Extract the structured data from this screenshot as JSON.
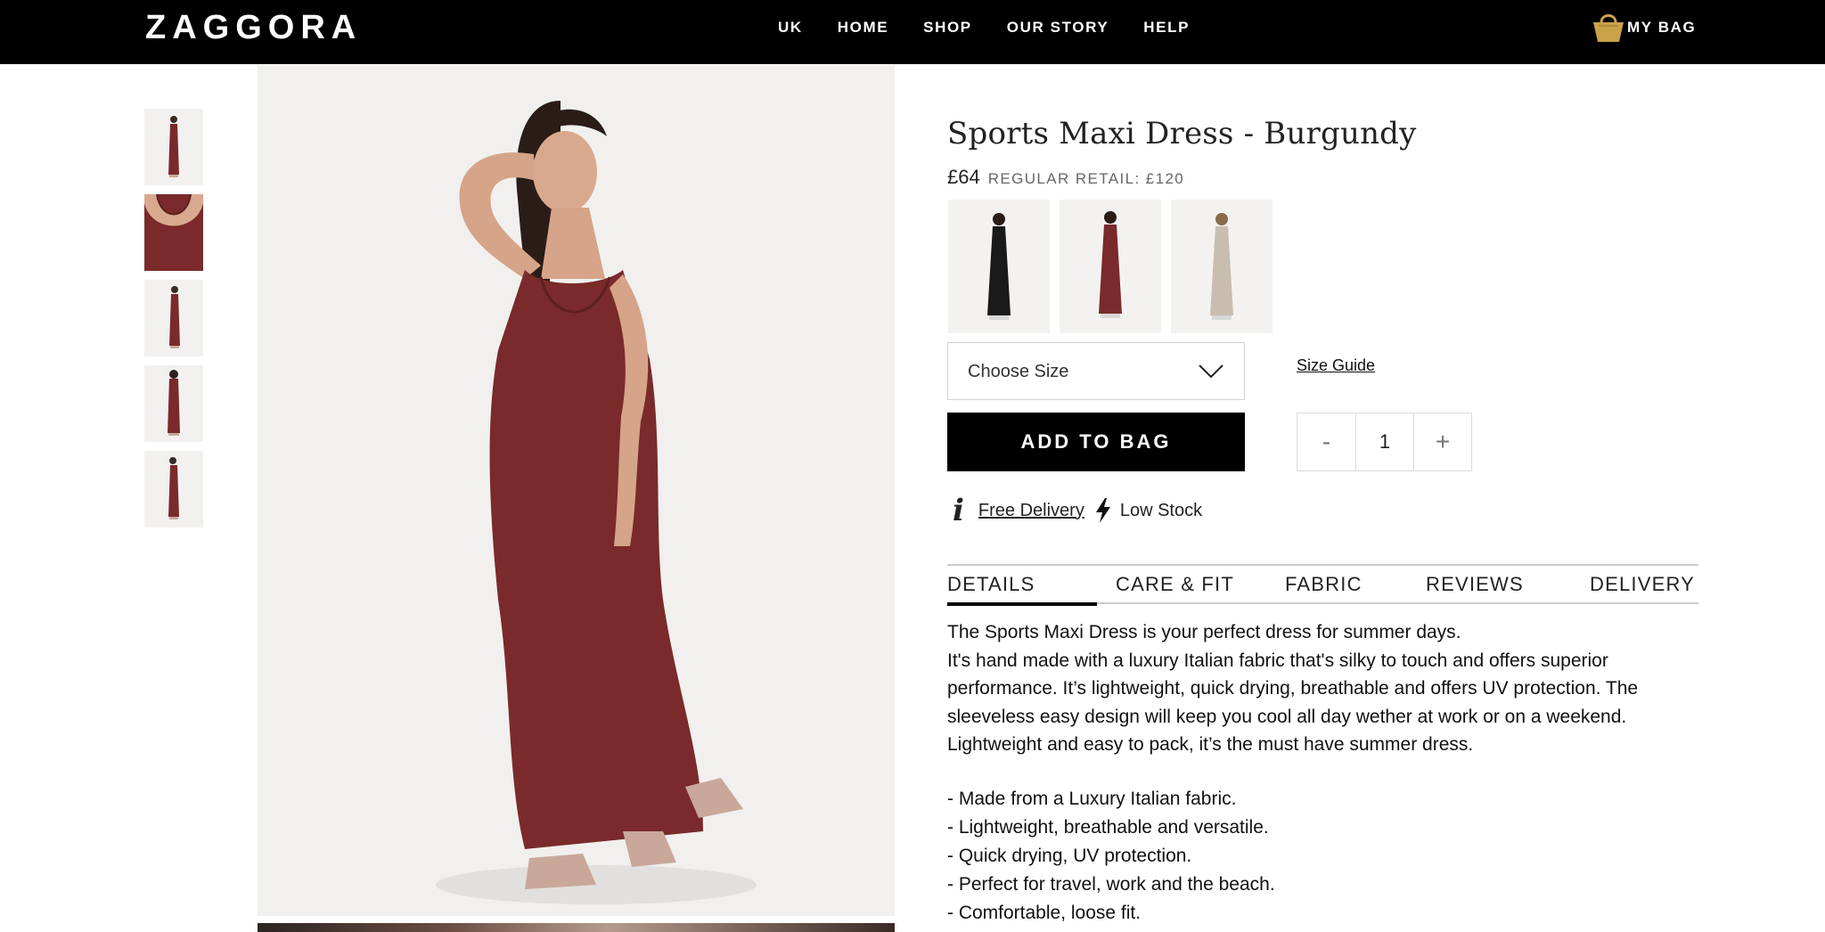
{
  "header": {
    "logo": "ZAGGORA",
    "nav": [
      {
        "label": "UK"
      },
      {
        "label": "HOME"
      },
      {
        "label": "SHOP"
      },
      {
        "label": "OUR STORY"
      },
      {
        "label": "HELP"
      }
    ],
    "bag_label": "MY BAG",
    "bag_icon": "shopping-basket-icon"
  },
  "colors": {
    "header_bg": "#000000",
    "accent_gold": "#c9a24a",
    "dress_burgundy": "#7a2a2a",
    "button_bg": "#000000"
  },
  "product": {
    "title": "Sports Maxi Dress - Burgundy",
    "price": "£64",
    "regular_retail": "REGULAR RETAIL: £120",
    "swatches": [
      {
        "color": "black"
      },
      {
        "color": "burgundy"
      },
      {
        "color": "beige"
      }
    ],
    "size_select": {
      "placeholder": "Choose Size"
    },
    "size_guide": "Size Guide",
    "add_to_bag": "ADD TO BAG",
    "quantity": {
      "minus": "-",
      "value": "1",
      "plus": "+"
    },
    "free_delivery": "Free Delivery",
    "stock_status": "Low Stock"
  },
  "tabs": [
    {
      "label": "DETAILS",
      "active": true
    },
    {
      "label": "CARE & FIT"
    },
    {
      "label": "FABRIC"
    },
    {
      "label": "REVIEWS"
    },
    {
      "label": "DELIVERY"
    }
  ],
  "details": {
    "paragraph_lines": [
      "The Sports Maxi Dress is your perfect dress for summer days.",
      "It's hand made with a luxury Italian fabric that's silky to touch and offers superior",
      "performance. It’s lightweight, quick drying, breathable and offers UV protection. The",
      "sleeveless easy design will keep you cool all day wether at work or on a weekend.",
      "Lightweight and easy to pack, it’s the must have summer dress."
    ],
    "bullets": [
      "- Made from a Luxury Italian fabric.",
      "- Lightweight, breathable and versatile.",
      "- Quick drying, UV protection.",
      "- Perfect for travel, work and the beach.",
      "- Comfortable, loose fit."
    ]
  }
}
